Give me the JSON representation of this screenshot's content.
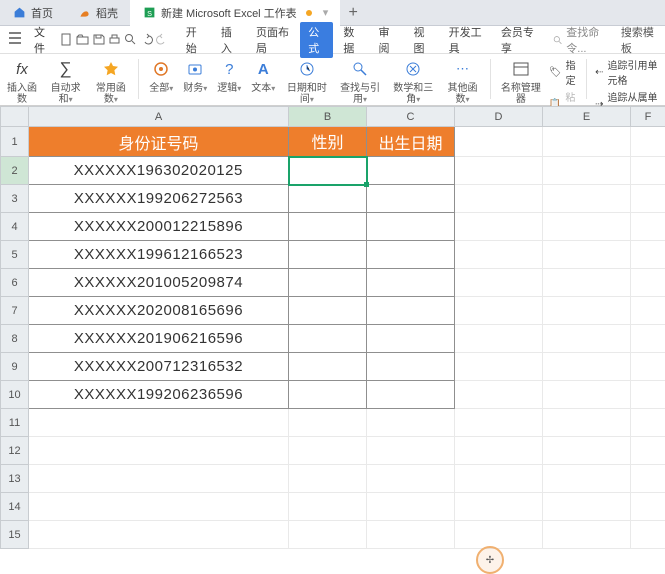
{
  "tabs": {
    "home": "首页",
    "shell": "稻壳",
    "doc": "新建 Microsoft Excel 工作表"
  },
  "menu": {
    "file": "文件"
  },
  "ribbon": {
    "tabs": [
      "开始",
      "插入",
      "页面布局",
      "公式",
      "数据",
      "审阅",
      "视图",
      "开发工具",
      "会员专享"
    ],
    "active_index": 3,
    "search_placeholder": "查找命令...",
    "templates": "搜索模板"
  },
  "tb": {
    "insert_fn": "插入函数",
    "autosum": "自动求和",
    "recent": "常用函数",
    "all": "全部",
    "financial": "财务",
    "logical": "逻辑",
    "text": "文本",
    "datetime": "日期和时间",
    "lookup": "查找与引用",
    "math": "数学和三角",
    "more": "其他函数",
    "name_mgr": "名称管理器",
    "define": "指定",
    "paste": "粘贴",
    "trace_ref": "追踪引用单元格",
    "trace_dep": "追踪从属单元格"
  },
  "cols": [
    "A",
    "B",
    "C",
    "D",
    "E",
    "F"
  ],
  "rows": [
    "1",
    "2",
    "3",
    "4",
    "5",
    "6",
    "7",
    "8",
    "9",
    "10",
    "11",
    "12",
    "13",
    "14",
    "15"
  ],
  "sheet": {
    "headers": {
      "a": "身份证号码",
      "b": "性别",
      "c": "出生日期"
    },
    "data": [
      "XXXXXX196302020125",
      "XXXXXX199206272563",
      "XXXXXX200012215896",
      "XXXXXX199612166523",
      "XXXXXX201005209874",
      "XXXXXX202008165696",
      "XXXXXX201906216596",
      "XXXXXX200712316532",
      "XXXXXX199206236596"
    ]
  },
  "fx": "fx"
}
